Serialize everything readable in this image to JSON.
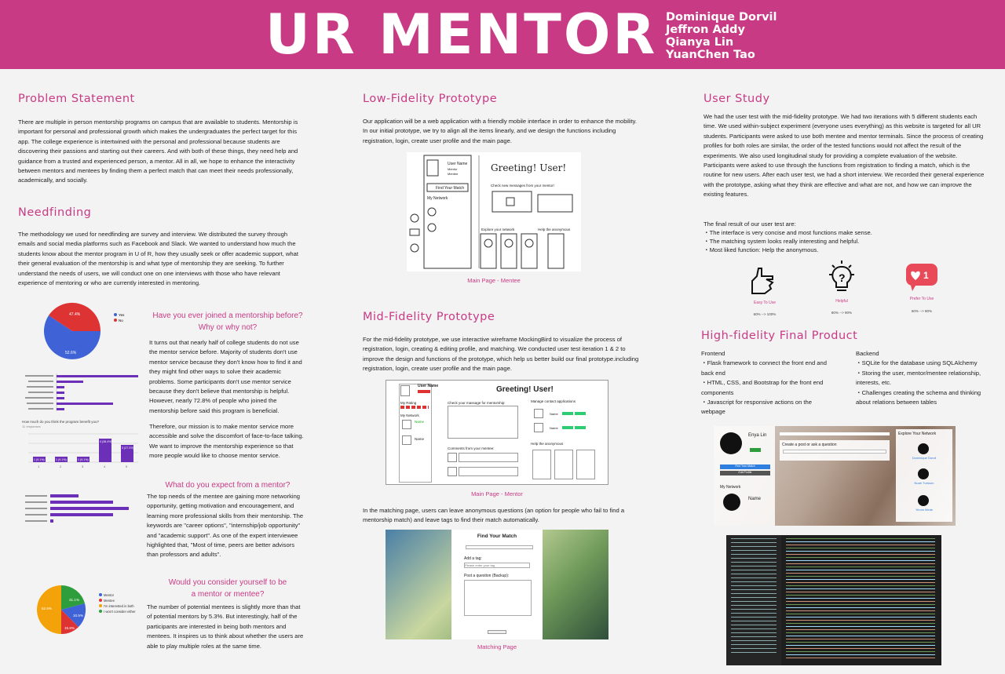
{
  "header": {
    "title": "UR MENTOR",
    "authors": [
      "Dominique Dorvil",
      "Jeffron Addy",
      "Qianya Lin",
      "YuanChen Tao"
    ]
  },
  "problem": {
    "title": "Problem Statement",
    "text": "There are multiple in person mentorship programs on campus that are available to students. Mentorship is important for personal and professional growth which makes the undergraduates the perfect target for this app. The college experience is intertwined with the personal and professional because students are discovering their passions and starting out their careers. And with both of these things, they need help and guidance from a trusted and experienced person, a mentor. All in all, we hope to enhance the interactivity between mentors and mentees by finding them a perfect match that can meet their needs professionally, academically, and socially."
  },
  "needfinding": {
    "title": "Needfinding",
    "text": "The methodology we used for needfinding are survey and interview. We distributed the survey through emails and social media platforms such as Facebook and Slack. We wanted to understand how much the students know about the mentor program in U of R, how they usually seek or offer academic support, what their general evaluation of the mentorship is and what type of mentorship they are seeking. To further understand the needs of users, we will conduct one on one interviews with those who have relevant experience of mentoring or who are currently interested in mentoring."
  },
  "q1": {
    "title_a": "Have you ever joined a mentorship before?",
    "title_b": "Why or why not?",
    "text1": "It turns out that nearly half of college students do not use the mentor service before. Majority of students don't use mentor service because they don't know how to find it and they might find other ways to solve their academic problems. Some participants don't use mentor service because they don't believe that mentorship is helpful. However, nearly 72.8% of people who joined the mentorship before said this program is beneficial.",
    "text2": "Therefore, our mission is to make mentor service more accessible and solve the discomfort of face-to-face talking. We want to improve the mentorship experience so that more people would like to choose mentor service."
  },
  "q2": {
    "title": "What do you expect from a mentor?",
    "text": "The top needs of the mentee are gaining more networking opportunity, getting motivation and encouragement, and learning more professional skills from their mentorship. The keywords are \"career options\", \"internship/job opportunity\" and \"academic support\". As one of the expert interviewee highlighted that, \"Most of time, peers are better advisors than professors and adults\"."
  },
  "q3": {
    "title_a": "Would you consider yourself to be",
    "title_b": "a mentor or mentee?",
    "text": "The number of potential mentees is slightly more than that of potential mentors by 5.3%. But interestingly, half of the participants are interested in being both mentors and mentees. It inspires us to think about whether the users are able to play multiple roles at the same time."
  },
  "pie1": {
    "legend": [
      "Yes",
      "No"
    ],
    "labels": [
      "47.4%",
      "52.6%"
    ],
    "colors": [
      "#d33",
      "#3f62d6"
    ]
  },
  "pie2": {
    "legend": [
      "Mentor",
      "Mentee",
      "I'm interested in both",
      "I won't consider either"
    ],
    "labels": [
      "31.1%",
      "10.5%",
      "15.8%",
      "52.6%"
    ],
    "colors": [
      "#3f62d6",
      "#d33",
      "#f4a20a",
      "#2e9e3c"
    ]
  },
  "bar2": {
    "title": "How much do you think the program benefit you?",
    "subtitle": "11 responses",
    "values": [
      "1 (9.1%)",
      "1 (9.1%)",
      "1 (9.1%)",
      "4 (36.4%)",
      "3 (27.3%)"
    ],
    "ticks": [
      "1",
      "2",
      "3",
      "4",
      "5"
    ]
  },
  "lofi": {
    "title": "Low-Fidelity Prototype",
    "text": "Our application will be a web application with a friendly mobile interface in order to enhance the mobility. In our initial prototype, we try to align all the items linearly, and we design the functions including registration, login, create user profile and the main page.",
    "caption": "Main Page - Mentee",
    "sketch": {
      "user": "User Name",
      "mentor": "Mentor",
      "mentee": "Mentee",
      "find": "Find Your Match",
      "network": "My Network",
      "greeting": "Greeting! User!",
      "messages": "Check new messages from your mentor!",
      "explore": "Explore your network",
      "help": "Help the anonymous"
    }
  },
  "midfi": {
    "title": "Mid-Fidelity Prototype",
    "text": "For the mid-fidelity prototype, we use interactive wireframe MockingBird to visualize the process of registration, login, creating & editing profile, and matching. We conducted user test iteration 1 & 2 to improve the design and functions of the prototype, which help us better build our final prototype.including registration, login, create user profile and the main page.",
    "caption": "Main Page - Mentor",
    "wire": {
      "user": "User Name",
      "rating": "My Rating",
      "network": "My Network",
      "name": "Name",
      "greeting": "Greeting!  User!",
      "check": "Check your massage for mentorship:",
      "comments": "Comments from your mentee:",
      "manage": "Manage contact applications",
      "help": "Help the anonymous"
    },
    "text2": "In the matching page, users can leave anonymous questions (an option for people who fail to find a mentorship match) and leave tags to find their match automatically.",
    "caption2": "Matching Page",
    "match": {
      "title": "Find Your Match",
      "tag": "Add a tag:",
      "tag_ph": "Please enter your tag",
      "post": "Post a question (Backup):"
    }
  },
  "study": {
    "title": "User Study",
    "text": "We had the user test with the mid-fidelity prototype. We had two iterations with 5 different students each time. We used within-subject experiment (everyone uses everything) as this website is targeted for all UR students. Participants were asked to use both mentee and mentor terminals. Since the process of creating profiles for both roles are similar, the order of the tested functions would not affect the result of the experiments. We also used longitudinal study for providing a complete evaluation of the website. Participants were asked to use through the functions from registration to finding a match, which is the routine for new users. After each user test, we had a short interview. We recorded their general experience with the prototype, asking what they think are effective and what are not, and how we can improve the existing features.",
    "result_title": "The final result of our user test are:",
    "results": [
      "・The interface is very concise and most functions make sense.",
      "・The matching system looks really interesting and helpful.",
      "・Most liked function: Help the anonymous."
    ],
    "icons": [
      {
        "label": "Easy To Use",
        "pct": "60% --> 100%"
      },
      {
        "label": "Helpful",
        "pct": "80% --> 90%"
      },
      {
        "label": "Prefer To Use",
        "pct": "60% --> 80%"
      }
    ],
    "badge": "1"
  },
  "hifi": {
    "title": "High-fidelity Final Product",
    "front_title": "Frontend",
    "front": [
      "・Flask framework  to connect the front end and back end",
      "・HTML, CSS, and Bootstrap for the front end components",
      "・Javascript for responsive actions on the webpage"
    ],
    "back_title": "Backend",
    "back": [
      "・SQLite for the database using SQLAlchemy",
      "・Storing the user, mentor/mentee relationship, interests, etc.",
      "・Challenges creating the schema and thinking about relations between tables"
    ],
    "screen": {
      "user": "Enya Lin",
      "post": "Create a post or ask a question",
      "network": "Explore Your Network",
      "my": "My Network",
      "name": "Name",
      "find": "Find Your Match",
      "edit": "Edit Profile",
      "people": [
        "Dominique Dorvil",
        "Noah Turkson",
        "Yeonn Mede"
      ]
    }
  }
}
